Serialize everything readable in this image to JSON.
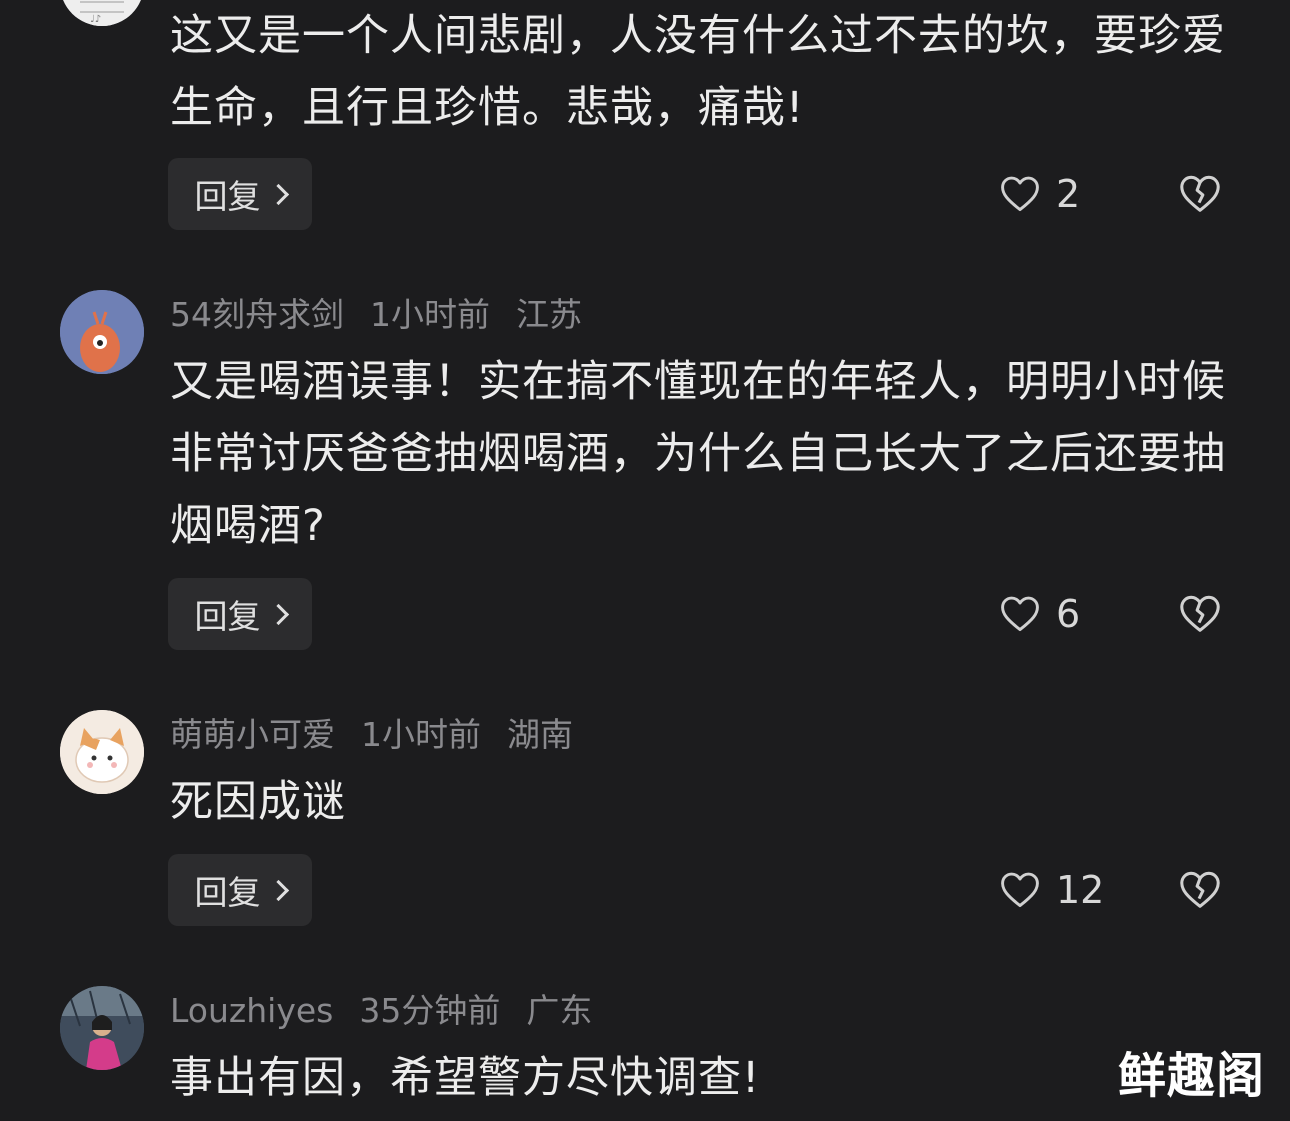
{
  "comments": [
    {
      "username": "",
      "time": "",
      "location": "",
      "text": "这又是一个人间悲剧，人没有什么过不去的坎，要珍爱生命，且行且珍惜。悲哉，痛哉!",
      "reply_label": "回复",
      "likes": "2"
    },
    {
      "username": "54刻舟求剑",
      "time": "1小时前",
      "location": "江苏",
      "text": "又是喝酒误事！实在搞不懂现在的年轻人，明明小时候非常讨厌爸爸抽烟喝酒，为什么自己长大了之后还要抽烟喝酒?",
      "reply_label": "回复",
      "likes": "6"
    },
    {
      "username": "萌萌小可爱",
      "time": "1小时前",
      "location": "湖南",
      "text": "死因成谜",
      "reply_label": "回复",
      "likes": "12"
    },
    {
      "username": "Louzhiyes",
      "time": "35分钟前",
      "location": "广东",
      "text": "事出有因，希望警方尽快调查!",
      "reply_label": "",
      "likes": ""
    }
  ],
  "icons": {
    "like": "heart-outline-icon",
    "dislike": "broken-heart-icon",
    "reply_chevron": "chevron-right-icon"
  },
  "watermark": "鲜趣阁",
  "colors": {
    "background": "#1c1c1e",
    "text": "#ececec",
    "meta": "#8a8a8e",
    "button_bg": "#2c2c2e"
  }
}
